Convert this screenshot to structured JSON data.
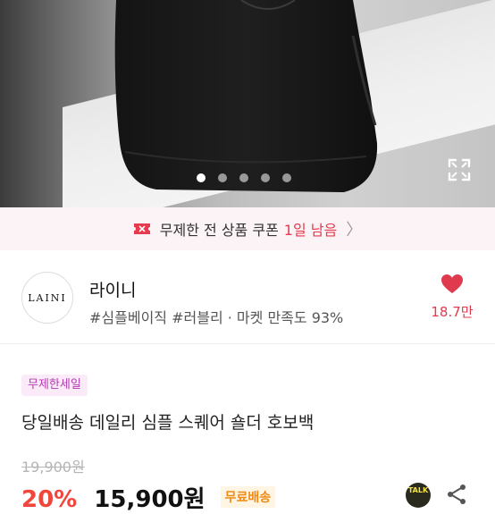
{
  "gallery": {
    "dot_count": 5,
    "active_index": 0
  },
  "coupon": {
    "text": "무제한 전 상품 쿠폰",
    "highlight": "1일 남음",
    "arrow": "〉",
    "accent_color": "#e8394f"
  },
  "shop": {
    "logo_text": "LAINI",
    "name": "라이니",
    "tags": "#심플베이직 #러블리 · 마켓 만족도 93%",
    "likes": "18.7만",
    "like_color": "#e03a4e"
  },
  "product": {
    "badge": "무제한세일",
    "title": "당일배송 데일리 심플 스퀘어 숄더 호보백",
    "original_price": "19,900원",
    "discount": "20%",
    "price": "15,900원",
    "shipping": "무료배송"
  },
  "actions": {
    "talk": "TALK"
  }
}
